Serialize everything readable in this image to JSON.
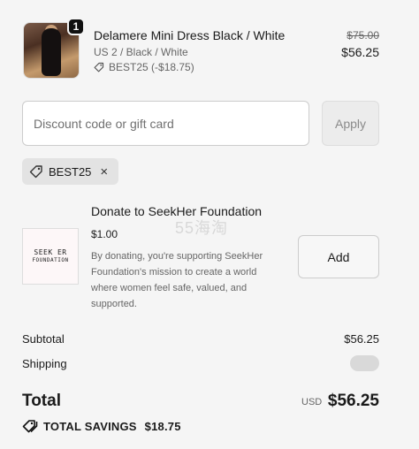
{
  "product": {
    "quantity": "1",
    "name": "Delamere Mini Dress Black / White",
    "variant": "US 2 / Black / White",
    "discount": "BEST25 (-$18.75)",
    "original_price": "$75.00",
    "price": "$56.25"
  },
  "discount_form": {
    "placeholder": "Discount code or gift card",
    "apply_label": "Apply",
    "applied_code": "BEST25",
    "remove_icon": "×"
  },
  "donation": {
    "title": "Donate to SeekHer Foundation",
    "amount": "$1.00",
    "description": "By donating, you're supporting SeekHer Foundation's mission to create a world where women feel safe, valued, and supported.",
    "logo_line1": "SEEK ER",
    "logo_line2": "FOUNDATION",
    "add_label": "Add"
  },
  "watermark": "55海淘",
  "totals": {
    "subtotal_label": "Subtotal",
    "subtotal_value": "$56.25",
    "shipping_label": "Shipping",
    "total_label": "Total",
    "currency": "USD",
    "total_value": "$56.25",
    "savings_label": "TOTAL SAVINGS",
    "savings_value": "$18.75"
  },
  "colors": {
    "background": "#f5f5f5",
    "text": "#1a1a1a",
    "muted": "#666666"
  }
}
